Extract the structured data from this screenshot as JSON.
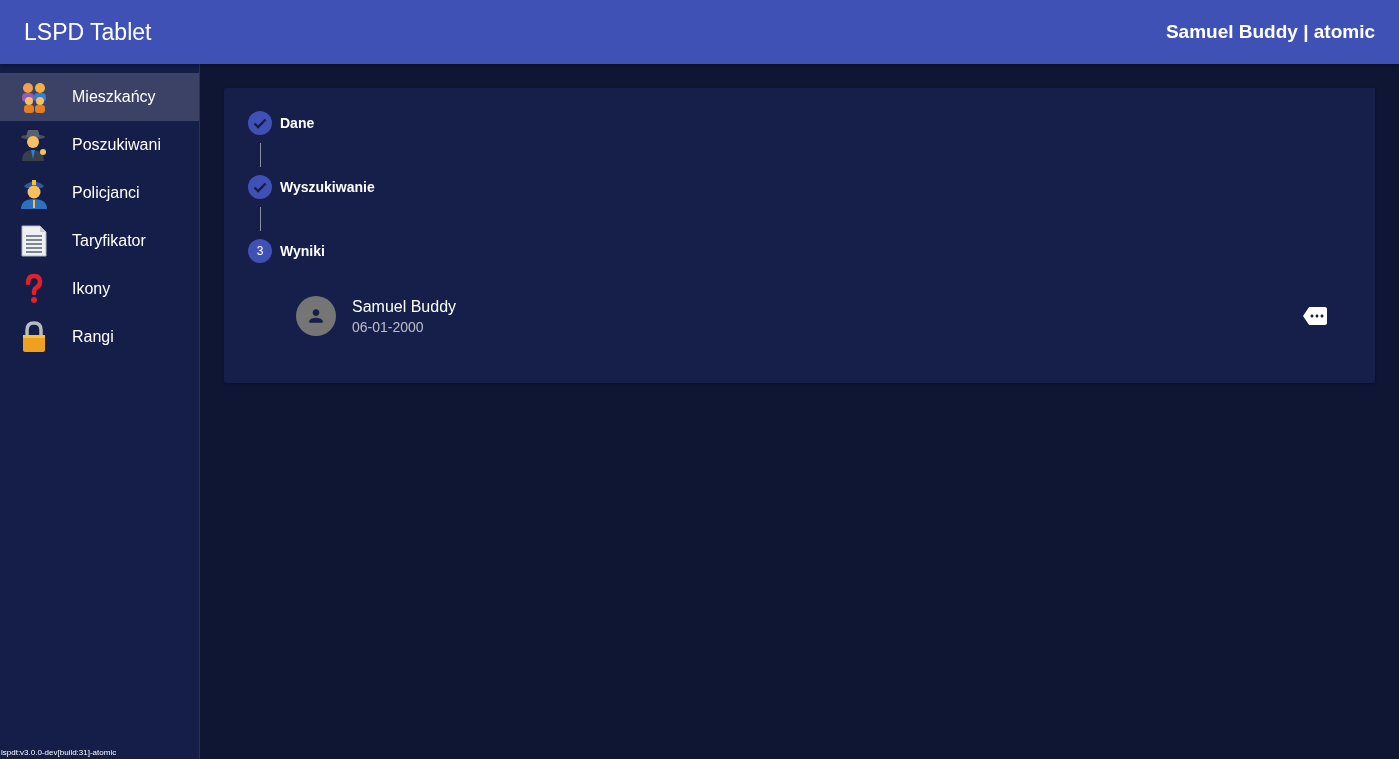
{
  "header": {
    "title": "LSPD Tablet",
    "user": "Samuel Buddy | atomic"
  },
  "sidebar": {
    "items": [
      {
        "label": "Mieszkańcy",
        "kind": "family",
        "selected": true
      },
      {
        "label": "Poszukiwani",
        "kind": "detective",
        "selected": false
      },
      {
        "label": "Policjanci",
        "kind": "police",
        "selected": false
      },
      {
        "label": "Taryfikator",
        "kind": "document",
        "selected": false
      },
      {
        "label": "Ikony",
        "kind": "question",
        "selected": false
      },
      {
        "label": "Rangi",
        "kind": "lock",
        "selected": false
      }
    ],
    "version": "lspdt:v3.0.0-dev[build:31]-atomic"
  },
  "stepper": {
    "steps": [
      {
        "label": "Dane",
        "completed": true
      },
      {
        "label": "Wyszukiwanie",
        "completed": true
      },
      {
        "label": "Wyniki",
        "completed": false,
        "number": "3"
      }
    ],
    "results": [
      {
        "name": "Samuel Buddy",
        "date": "06-01-2000"
      }
    ]
  }
}
